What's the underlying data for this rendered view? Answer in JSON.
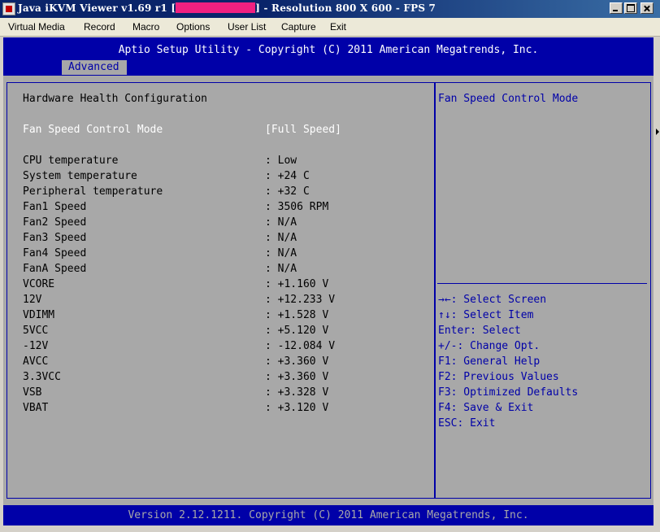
{
  "window": {
    "title_prefix": "Java iKVM Viewer v1.69 r1 [",
    "title_suffix": "] - Resolution 800 X 600 - FPS 7",
    "controls": [
      "minimize",
      "maximize",
      "close"
    ]
  },
  "menu": [
    "Virtual Media",
    "Record",
    "Macro",
    "Options",
    "User List",
    "Capture",
    "Exit"
  ],
  "bios": {
    "header": "Aptio Setup Utility - Copyright (C) 2011 American Megatrends, Inc.",
    "active_tab": "Advanced",
    "page_title": "Hardware Health Configuration",
    "selected_item": {
      "label": "Fan Speed Control Mode",
      "value": "[Full Speed]"
    },
    "readings": [
      {
        "label": "CPU temperature",
        "value": ": Low"
      },
      {
        "label": "System temperature",
        "value": ": +24 C"
      },
      {
        "label": "Peripheral temperature",
        "value": ": +32 C"
      },
      {
        "label": "Fan1 Speed",
        "value": ": 3506 RPM"
      },
      {
        "label": "Fan2 Speed",
        "value": ": N/A"
      },
      {
        "label": "Fan3 Speed",
        "value": ": N/A"
      },
      {
        "label": "Fan4 Speed",
        "value": ": N/A"
      },
      {
        "label": "FanA Speed",
        "value": ": N/A"
      },
      {
        "label": "VCORE",
        "value": ": +1.160 V"
      },
      {
        "label": "12V",
        "value": ": +12.233 V"
      },
      {
        "label": "VDIMM",
        "value": ": +1.528 V"
      },
      {
        "label": "5VCC",
        "value": ": +5.120 V"
      },
      {
        "label": "-12V",
        "value": ": -12.084 V"
      },
      {
        "label": "AVCC",
        "value": ": +3.360 V"
      },
      {
        "label": "3.3VCC",
        "value": ": +3.360 V"
      },
      {
        "label": "VSB",
        "value": ": +3.328 V"
      },
      {
        "label": "VBAT",
        "value": ": +3.120 V"
      }
    ],
    "help_title": "Fan Speed Control Mode",
    "help_keys": [
      "→←: Select Screen",
      "↑↓: Select Item",
      "Enter: Select",
      "+/-: Change Opt.",
      "F1: General Help",
      "F2: Previous Values",
      "F3: Optimized Defaults",
      "F4: Save & Exit",
      "ESC: Exit"
    ],
    "footer": "Version 2.12.1211. Copyright (C) 2011 American Megatrends, Inc."
  },
  "colors": {
    "bios_blue": "#0000a8",
    "bios_gray": "#a8a8a8",
    "highlight": "#ffffff",
    "redaction": "#f02080"
  }
}
